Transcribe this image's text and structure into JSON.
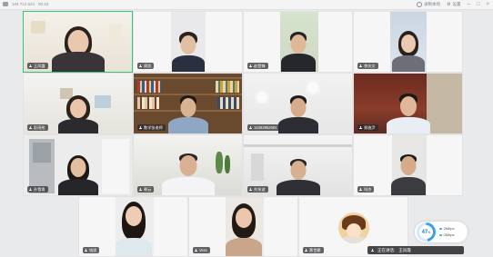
{
  "titlebar": {
    "left_text": "104 712 624 · 00:43",
    "record_label": "录制本场",
    "settings_label": "设置"
  },
  "tiles": [
    {
      "name": "王凤霞"
    },
    {
      "name": "周凯"
    },
    {
      "name": "赵登锋"
    },
    {
      "name": "李庆文"
    },
    {
      "name": "彭雨彤"
    },
    {
      "name": "数学张老师"
    },
    {
      "name": "15382952091"
    },
    {
      "name": "郑施尹"
    },
    {
      "name": "孙雪青"
    },
    {
      "name": "朝云"
    },
    {
      "name": "刘东波"
    },
    {
      "name": "叫杰"
    },
    {
      "name": "钱凯"
    },
    {
      "name": "Vera"
    },
    {
      "name": "黄世豪"
    }
  ],
  "speaking": {
    "label": "正在讲话:",
    "name": "王凤霞"
  },
  "network": {
    "percent": "47",
    "unit": "%",
    "up": "2Mbps",
    "down": "0Mbps"
  },
  "colors": {
    "active_border": "#39c07a",
    "accent": "#3aa0f0"
  }
}
